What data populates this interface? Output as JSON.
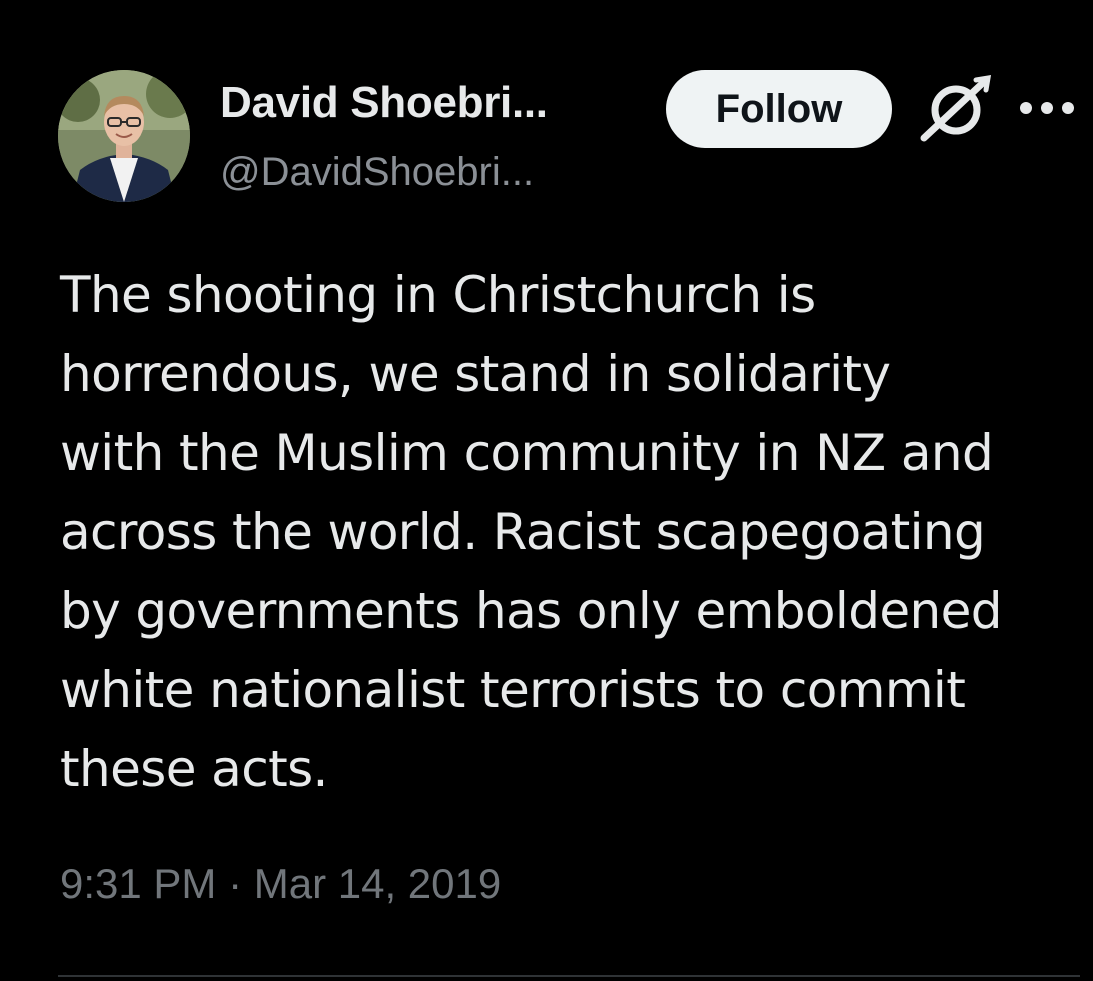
{
  "author": {
    "display_name": "David Shoebri...",
    "handle": "@DavidShoebri..."
  },
  "actions": {
    "follow_label": "Follow",
    "grok_icon": "grok-icon",
    "more_icon": "more-horizontal-icon"
  },
  "tweet": {
    "lines": [
      "The shooting in Christchurch is",
      "horrendous, we stand in solidarity",
      "with the Muslim community in NZ and",
      "across the world. Racist scapegoating",
      "by governments has only emboldened",
      "white nationalist terrorists to commit",
      "these acts."
    ],
    "timestamp": "9:31 PM · Mar 14, 2019"
  },
  "colors": {
    "background": "#000000",
    "text": "#e7e9ea",
    "secondary": "#71767b",
    "follow_bg": "#eff3f4",
    "follow_text": "#0f1419"
  }
}
